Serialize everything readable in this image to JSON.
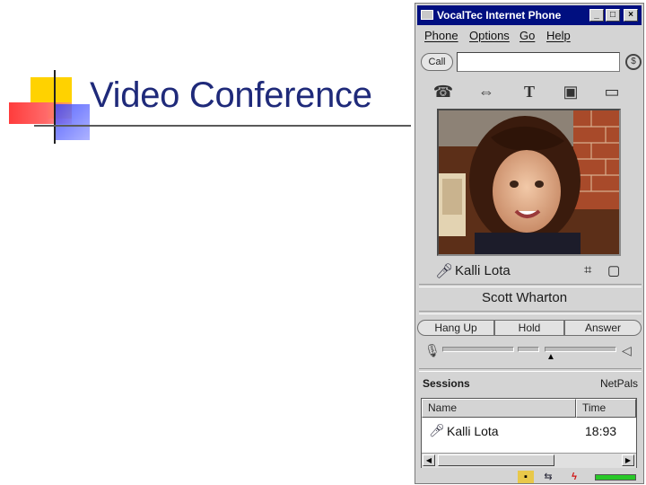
{
  "slide": {
    "title": "Video Conference"
  },
  "window": {
    "title": "VocalTec Internet Phone",
    "controls": {
      "minimize": "_",
      "maximize": "□",
      "close": "×"
    }
  },
  "menu": [
    "Phone",
    "Options",
    "Go",
    "Help"
  ],
  "call": {
    "button_label": "Call",
    "input_value": ""
  },
  "toolbar_icons": [
    "phone-icon",
    "transfer-icon",
    "text-icon",
    "whiteboard-icon",
    "folder-icon"
  ],
  "video": {
    "local_user": "Kalli Lota",
    "remote_user": "Scott Wharton"
  },
  "controls": {
    "hang_up": "Hang Up",
    "hold": "Hold",
    "answer": "Answer"
  },
  "sessions": {
    "heading": "Sessions",
    "netpals_label": "NetPals",
    "columns": [
      "Name",
      "Time"
    ],
    "rows": [
      {
        "name": "Kalli Lota",
        "time": "18:93"
      }
    ]
  },
  "colors": {
    "title_text": "#1f2a7a",
    "titlebar": "#000f80",
    "deco_yellow": "#ffd200",
    "deco_red": "#ff4b4b",
    "deco_blue": "#3f4fff",
    "status_green": "#28c828"
  }
}
